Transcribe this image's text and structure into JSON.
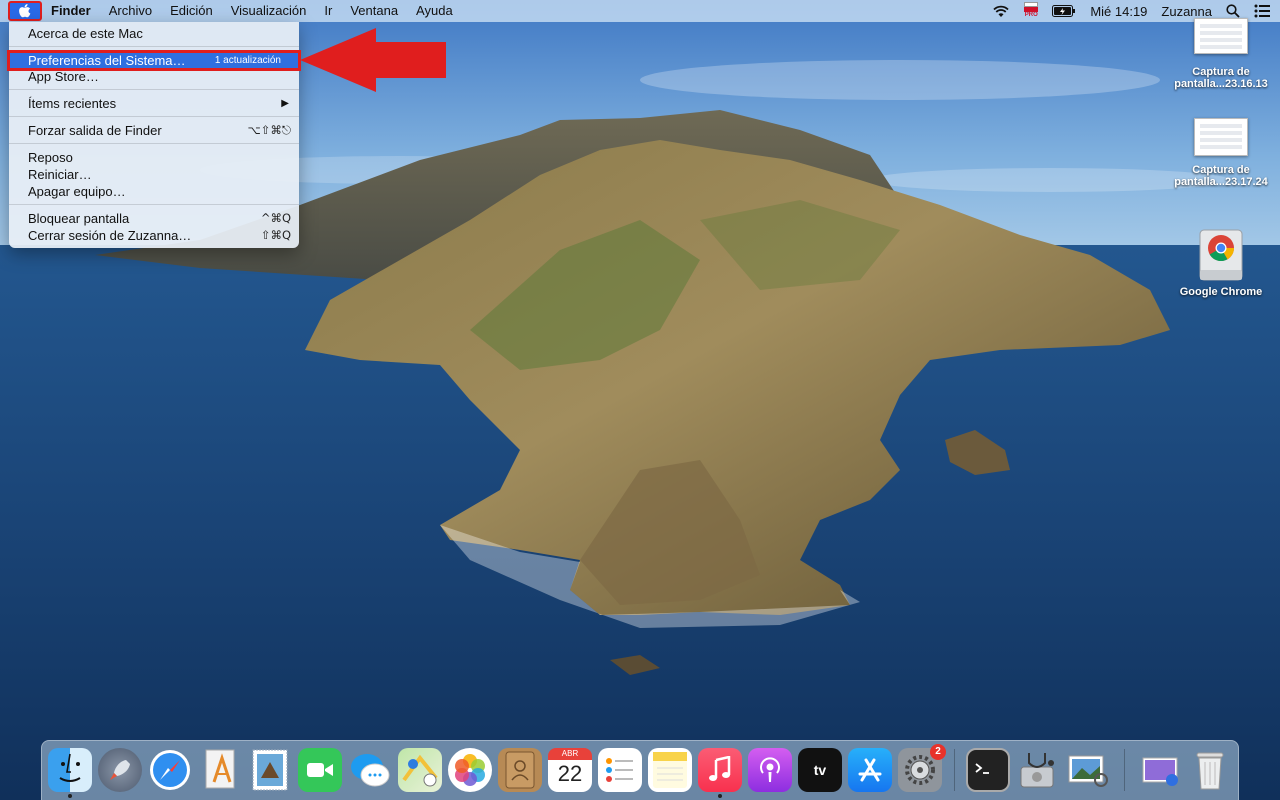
{
  "menubar": {
    "app_name": "Finder",
    "menus": [
      "Archivo",
      "Edición",
      "Visualización",
      "Ir",
      "Ventana",
      "Ayuda"
    ],
    "clock": "Mié 14:19",
    "user": "Zuzanna",
    "flag_label": "PRO"
  },
  "apple_menu": {
    "items": {
      "about": "Acerca de este Mac",
      "system_prefs": "Preferencias del Sistema…",
      "system_prefs_badge": "1 actualización",
      "app_store": "App Store…",
      "recent": "Ítems recientes",
      "force_quit": "Forzar salida de Finder",
      "force_quit_shortcut": "⌥⇧⌘⎋",
      "sleep": "Reposo",
      "restart": "Reiniciar…",
      "shutdown": "Apagar equipo…",
      "lock": "Bloquear pantalla",
      "lock_shortcut": "^⌘Q",
      "logout": "Cerrar sesión de Zuzanna…",
      "logout_shortcut": "⇧⌘Q"
    }
  },
  "desktop": {
    "icons": [
      {
        "line1": "Captura de",
        "line2": "pantalla...23.16.13"
      },
      {
        "line1": "Captura de",
        "line2": "pantalla...23.17.24"
      },
      {
        "line1": "Google Chrome",
        "line2": ""
      }
    ]
  },
  "dock": {
    "calendar_month": "ABR",
    "calendar_day": "22",
    "appletv_label": "tv",
    "sysprefs_badge": "2"
  },
  "colors": {
    "highlight": "#2f6fe0",
    "annotation_red": "#e01e1e"
  }
}
